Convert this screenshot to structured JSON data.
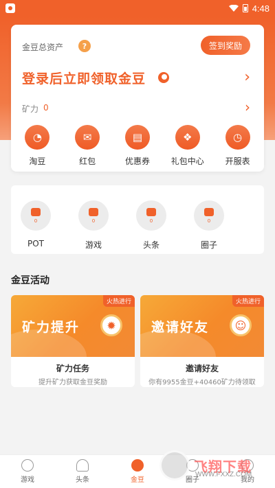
{
  "status_bar": {
    "time": "4:48"
  },
  "asset_card": {
    "label": "金豆总资产",
    "help_icon": "?",
    "checkin_button": "签到奖励",
    "login_prompt": "登录后立即领取金豆",
    "mining_label": "矿力",
    "mining_value": "0"
  },
  "quick_actions": [
    {
      "label": "淘豆",
      "icon": "bean-icon"
    },
    {
      "label": "红包",
      "icon": "red-envelope-icon"
    },
    {
      "label": "优惠券",
      "icon": "coupon-icon"
    },
    {
      "label": "礼包中心",
      "icon": "gift-icon"
    },
    {
      "label": "开服表",
      "icon": "clock-icon"
    }
  ],
  "stats": [
    {
      "label": "POT",
      "count": "0",
      "icon": "pot-icon"
    },
    {
      "label": "游戏",
      "count": "0",
      "icon": "game-icon"
    },
    {
      "label": "头条",
      "count": "0",
      "icon": "news-icon"
    },
    {
      "label": "圈子",
      "count": "0",
      "icon": "group-icon"
    }
  ],
  "activities_title": "金豆活动",
  "activities": [
    {
      "badge": "火热进行",
      "banner_text": "矿力提升",
      "title": "矿力任务",
      "desc": "提升矿力获取金豆奖励"
    },
    {
      "badge": "火热进行",
      "banner_text": "邀请好友",
      "title": "邀请好友",
      "desc": "你有9955金豆+40460矿力待领取"
    }
  ],
  "bottom_nav": [
    {
      "label": "游戏",
      "icon": "game-controller-icon",
      "active": false
    },
    {
      "label": "头条",
      "icon": "bell-icon",
      "active": false
    },
    {
      "label": "金豆",
      "icon": "bean-icon",
      "active": true
    },
    {
      "label": "圈子",
      "icon": "group-icon",
      "active": false
    },
    {
      "label": "我的",
      "icon": "user-icon",
      "active": false
    }
  ],
  "watermark": {
    "text": "飞翔下载",
    "url": "WWW.FXXZ.COM"
  }
}
